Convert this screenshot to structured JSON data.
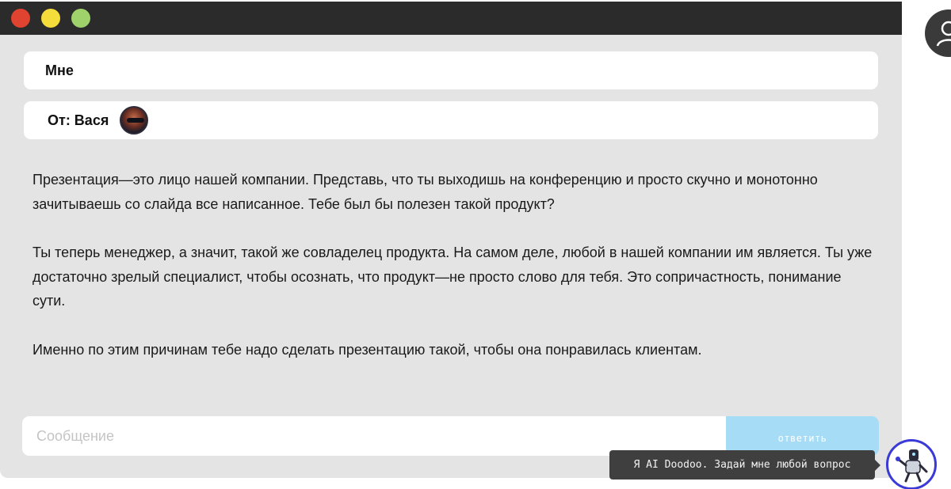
{
  "window": {
    "controls": [
      "close",
      "minimize",
      "maximize"
    ]
  },
  "mail": {
    "to": "Мне",
    "from_label": "От: Вася",
    "paragraphs": [
      "Презентация—это лицо нашей компании. Представь, что ты выходишь на конференцию и просто скучно и монотонно зачитываешь со слайда все написанное. Тебе был бы полезен такой продукт?",
      "Ты теперь менеджер, а значит, такой же совладелец продукта. На самом деле, любой в нашей компании им является. Ты уже достаточно зрелый специалист, чтобы осознать, что продукт—не просто слово для тебя. Это сопричастность, понимание сути.",
      "Именно по этим причинам тебе надо сделать презентацию такой, чтобы она понравилась клиентам."
    ]
  },
  "reply": {
    "placeholder": "Сообщение",
    "button_label": "ответить"
  },
  "assistant": {
    "tooltip": "Я AI Doodoo. Задай мне любой вопрос",
    "icon": "robot-icon"
  },
  "colors": {
    "titlebar": "#2b2b2b",
    "window_bg": "#e4e4e4",
    "button": "#a7dcf7",
    "close": "#e0432f",
    "minimize": "#f4dc3a",
    "maximize": "#9fd26a"
  }
}
